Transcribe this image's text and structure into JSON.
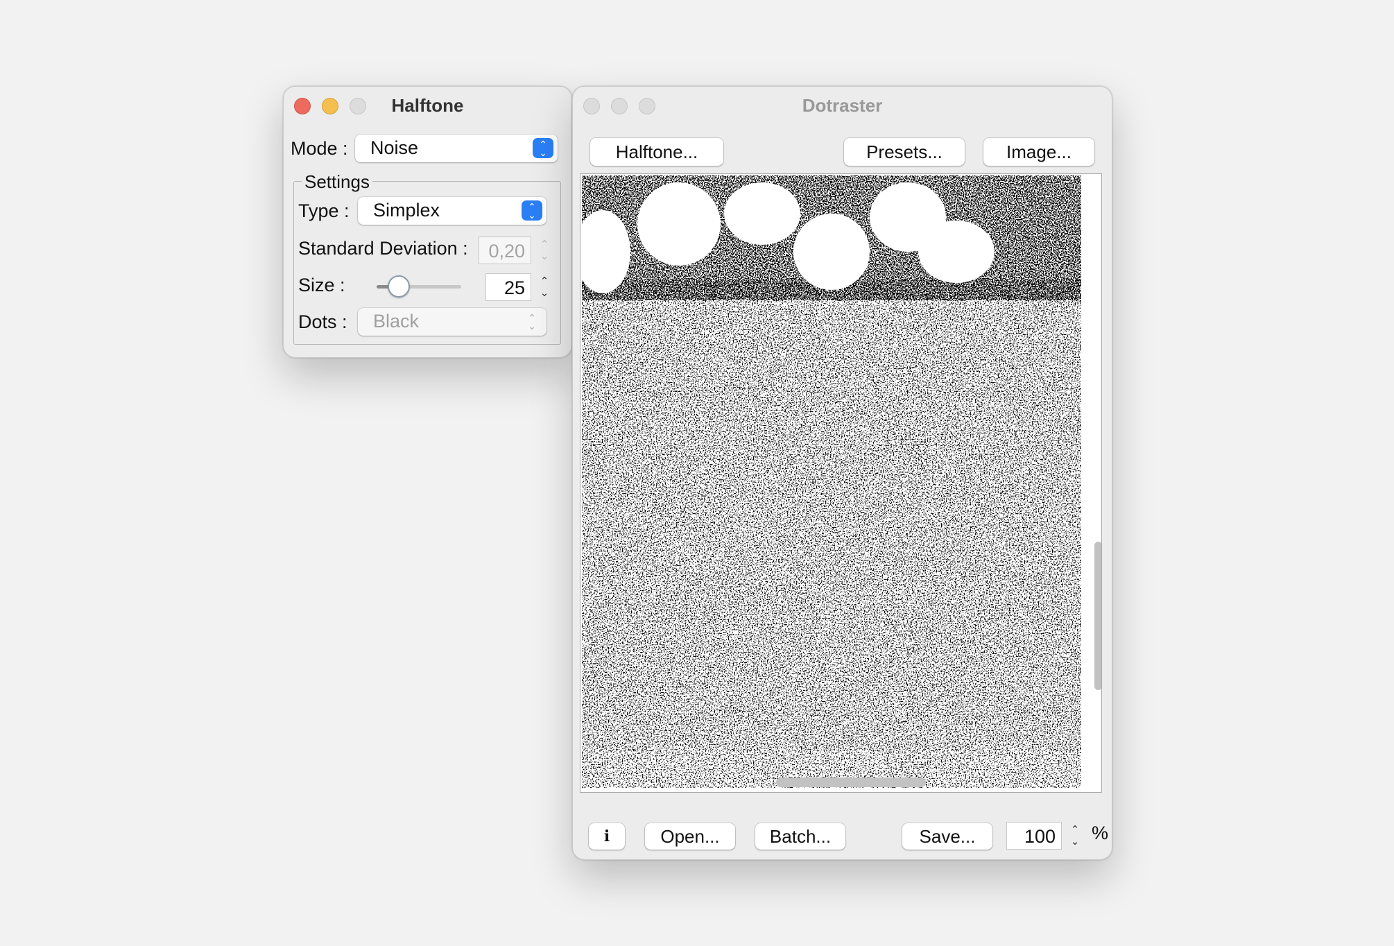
{
  "halftone_window": {
    "title": "Halftone",
    "mode_label": "Mode :",
    "mode_value": "Noise",
    "settings_label": "Settings",
    "type_label": "Type :",
    "type_value": "Simplex",
    "std_dev_label": "Standard Deviation :",
    "std_dev_value": "0,20",
    "size_label": "Size :",
    "size_value": "25",
    "dots_label": "Dots :",
    "dots_value": "Black"
  },
  "dotraster_window": {
    "title": "Dotraster",
    "toolbar": {
      "halftone_button": "Halftone...",
      "presets_button": "Presets...",
      "image_button": "Image..."
    },
    "bottom_bar": {
      "info_button": "i",
      "open_button": "Open...",
      "batch_button": "Batch...",
      "save_button": "Save...",
      "zoom_value": "100",
      "zoom_unit": "%"
    }
  },
  "colors": {
    "close": "#ed6a5e",
    "minimize": "#f5bf4f",
    "accent": "#2b7ff5"
  },
  "icons": [
    "up-down-chevron-icon",
    "stepper-arrows-icon",
    "info-icon"
  ]
}
